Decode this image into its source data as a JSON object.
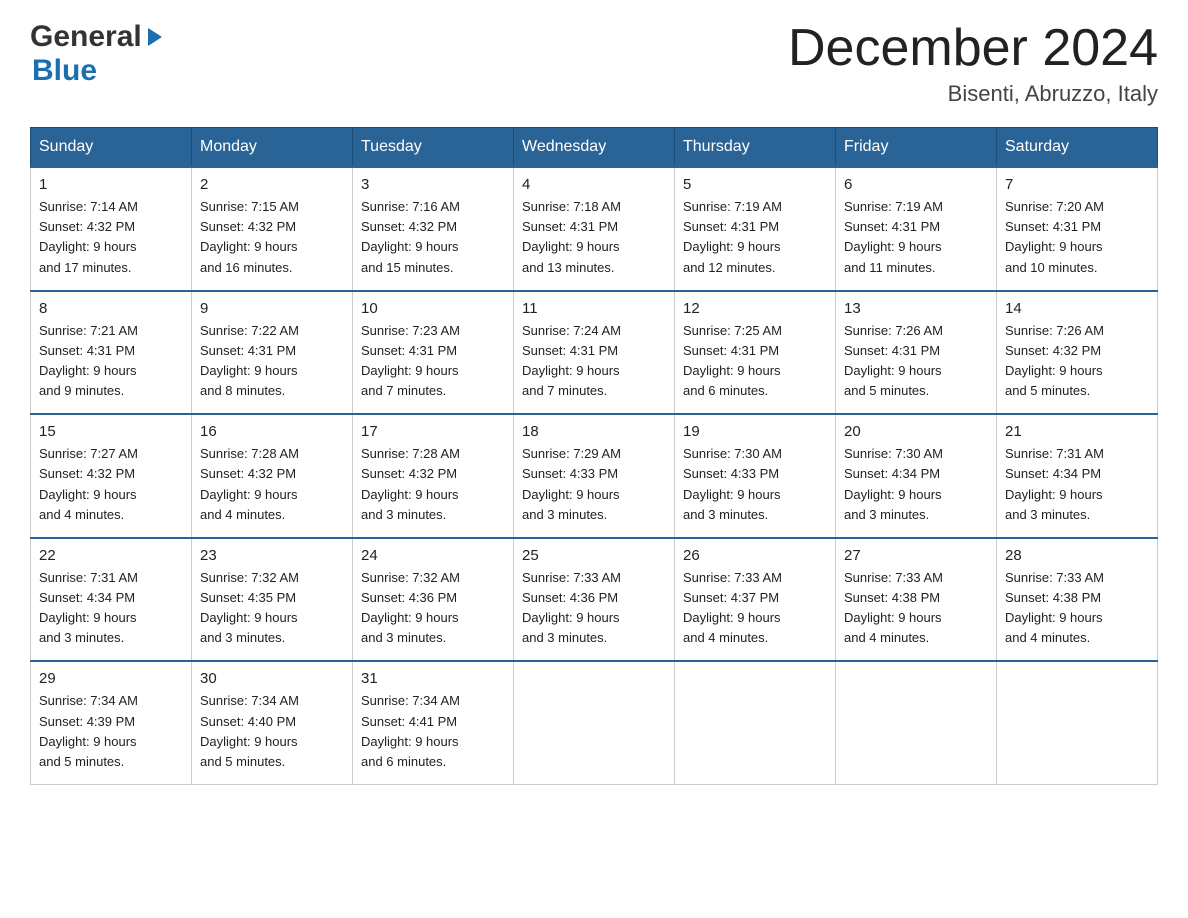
{
  "header": {
    "logo_general": "General",
    "logo_blue": "Blue",
    "month_title": "December 2024",
    "location": "Bisenti, Abruzzo, Italy"
  },
  "days_of_week": [
    "Sunday",
    "Monday",
    "Tuesday",
    "Wednesday",
    "Thursday",
    "Friday",
    "Saturday"
  ],
  "weeks": [
    [
      {
        "day": "1",
        "sunrise": "7:14 AM",
        "sunset": "4:32 PM",
        "daylight": "9 hours and 17 minutes."
      },
      {
        "day": "2",
        "sunrise": "7:15 AM",
        "sunset": "4:32 PM",
        "daylight": "9 hours and 16 minutes."
      },
      {
        "day": "3",
        "sunrise": "7:16 AM",
        "sunset": "4:32 PM",
        "daylight": "9 hours and 15 minutes."
      },
      {
        "day": "4",
        "sunrise": "7:18 AM",
        "sunset": "4:31 PM",
        "daylight": "9 hours and 13 minutes."
      },
      {
        "day": "5",
        "sunrise": "7:19 AM",
        "sunset": "4:31 PM",
        "daylight": "9 hours and 12 minutes."
      },
      {
        "day": "6",
        "sunrise": "7:19 AM",
        "sunset": "4:31 PM",
        "daylight": "9 hours and 11 minutes."
      },
      {
        "day": "7",
        "sunrise": "7:20 AM",
        "sunset": "4:31 PM",
        "daylight": "9 hours and 10 minutes."
      }
    ],
    [
      {
        "day": "8",
        "sunrise": "7:21 AM",
        "sunset": "4:31 PM",
        "daylight": "9 hours and 9 minutes."
      },
      {
        "day": "9",
        "sunrise": "7:22 AM",
        "sunset": "4:31 PM",
        "daylight": "9 hours and 8 minutes."
      },
      {
        "day": "10",
        "sunrise": "7:23 AM",
        "sunset": "4:31 PM",
        "daylight": "9 hours and 7 minutes."
      },
      {
        "day": "11",
        "sunrise": "7:24 AM",
        "sunset": "4:31 PM",
        "daylight": "9 hours and 7 minutes."
      },
      {
        "day": "12",
        "sunrise": "7:25 AM",
        "sunset": "4:31 PM",
        "daylight": "9 hours and 6 minutes."
      },
      {
        "day": "13",
        "sunrise": "7:26 AM",
        "sunset": "4:31 PM",
        "daylight": "9 hours and 5 minutes."
      },
      {
        "day": "14",
        "sunrise": "7:26 AM",
        "sunset": "4:32 PM",
        "daylight": "9 hours and 5 minutes."
      }
    ],
    [
      {
        "day": "15",
        "sunrise": "7:27 AM",
        "sunset": "4:32 PM",
        "daylight": "9 hours and 4 minutes."
      },
      {
        "day": "16",
        "sunrise": "7:28 AM",
        "sunset": "4:32 PM",
        "daylight": "9 hours and 4 minutes."
      },
      {
        "day": "17",
        "sunrise": "7:28 AM",
        "sunset": "4:32 PM",
        "daylight": "9 hours and 3 minutes."
      },
      {
        "day": "18",
        "sunrise": "7:29 AM",
        "sunset": "4:33 PM",
        "daylight": "9 hours and 3 minutes."
      },
      {
        "day": "19",
        "sunrise": "7:30 AM",
        "sunset": "4:33 PM",
        "daylight": "9 hours and 3 minutes."
      },
      {
        "day": "20",
        "sunrise": "7:30 AM",
        "sunset": "4:34 PM",
        "daylight": "9 hours and 3 minutes."
      },
      {
        "day": "21",
        "sunrise": "7:31 AM",
        "sunset": "4:34 PM",
        "daylight": "9 hours and 3 minutes."
      }
    ],
    [
      {
        "day": "22",
        "sunrise": "7:31 AM",
        "sunset": "4:34 PM",
        "daylight": "9 hours and 3 minutes."
      },
      {
        "day": "23",
        "sunrise": "7:32 AM",
        "sunset": "4:35 PM",
        "daylight": "9 hours and 3 minutes."
      },
      {
        "day": "24",
        "sunrise": "7:32 AM",
        "sunset": "4:36 PM",
        "daylight": "9 hours and 3 minutes."
      },
      {
        "day": "25",
        "sunrise": "7:33 AM",
        "sunset": "4:36 PM",
        "daylight": "9 hours and 3 minutes."
      },
      {
        "day": "26",
        "sunrise": "7:33 AM",
        "sunset": "4:37 PM",
        "daylight": "9 hours and 4 minutes."
      },
      {
        "day": "27",
        "sunrise": "7:33 AM",
        "sunset": "4:38 PM",
        "daylight": "9 hours and 4 minutes."
      },
      {
        "day": "28",
        "sunrise": "7:33 AM",
        "sunset": "4:38 PM",
        "daylight": "9 hours and 4 minutes."
      }
    ],
    [
      {
        "day": "29",
        "sunrise": "7:34 AM",
        "sunset": "4:39 PM",
        "daylight": "9 hours and 5 minutes."
      },
      {
        "day": "30",
        "sunrise": "7:34 AM",
        "sunset": "4:40 PM",
        "daylight": "9 hours and 5 minutes."
      },
      {
        "day": "31",
        "sunrise": "7:34 AM",
        "sunset": "4:41 PM",
        "daylight": "9 hours and 6 minutes."
      },
      null,
      null,
      null,
      null
    ]
  ],
  "labels": {
    "sunrise": "Sunrise:",
    "sunset": "Sunset:",
    "daylight": "Daylight:"
  }
}
